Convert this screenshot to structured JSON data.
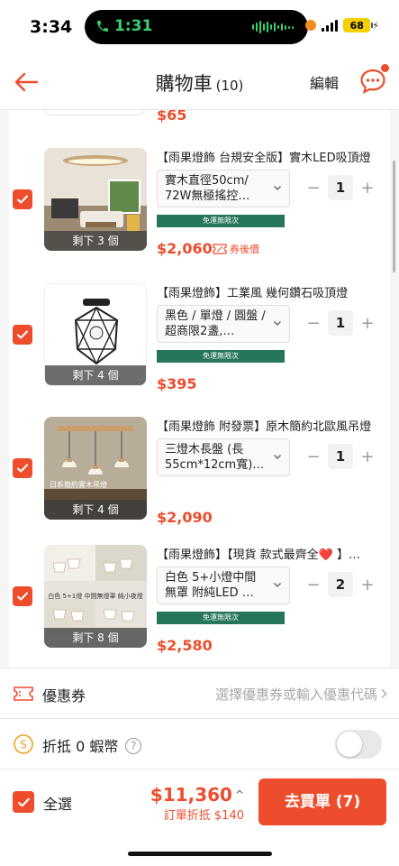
{
  "status_bar": {
    "time": "3:34",
    "call_timer": "1:31",
    "battery": "68"
  },
  "header": {
    "title": "購物車",
    "count": "(10)",
    "edit_label": "編輯"
  },
  "previous_item": {
    "price": "$65"
  },
  "items": [
    {
      "name": "【雨果燈飾 台規安全版】實木LED吸頂燈",
      "variant": "實木直徑50cm/ 72W無極搖控…",
      "badge": "免運無限次",
      "price": "$2,060",
      "voucher_tag": "券後價",
      "quantity": "1",
      "stock_label": "剩下 3 個",
      "thumb_caption": ""
    },
    {
      "name": "【雨果燈飾】工業風 幾何鑽石吸頂燈",
      "variant": "黑色 / 單燈 / 圓盤 / 超商限2盞,…",
      "badge": "免運無限次",
      "price": "$395",
      "voucher_tag": "",
      "quantity": "1",
      "stock_label": "剩下 4 個",
      "thumb_caption": ""
    },
    {
      "name": "【雨果燈飾 附發票】原木簡約北歐風吊燈",
      "variant": "三燈木長盤 (長55cm*12cm寬)…",
      "badge": "",
      "price": "$2,090",
      "voucher_tag": "",
      "quantity": "1",
      "stock_label": "剩下 4 個",
      "thumb_caption": "日系簡約實木吊燈"
    },
    {
      "name": "【雨果燈飾】【現貨 款式最齊全❤️ 】…",
      "variant": "白色 5+小燈中間無罩 附純LED …",
      "badge": "免運無限次",
      "price": "$2,580",
      "voucher_tag": "",
      "quantity": "2",
      "stock_label": "剩下 8 個",
      "thumb_caption": "白色 5+1燈 中間無燈罩 純小夜燈"
    }
  ],
  "qty_controls": {
    "minus": "−",
    "plus": "+"
  },
  "voucher_row": {
    "label": "優惠券",
    "hint": "選擇優惠券或輸入優惠代碼"
  },
  "coins_row": {
    "label": "折抵 0 蝦幣",
    "help": "?"
  },
  "checkout": {
    "select_all_label": "全選",
    "total": "$11,360",
    "savings": "訂單折抵 $140",
    "buy_label": "去買單 (7)"
  },
  "colors": {
    "accent": "#ee4d2d",
    "badge_green": "#26765a"
  }
}
